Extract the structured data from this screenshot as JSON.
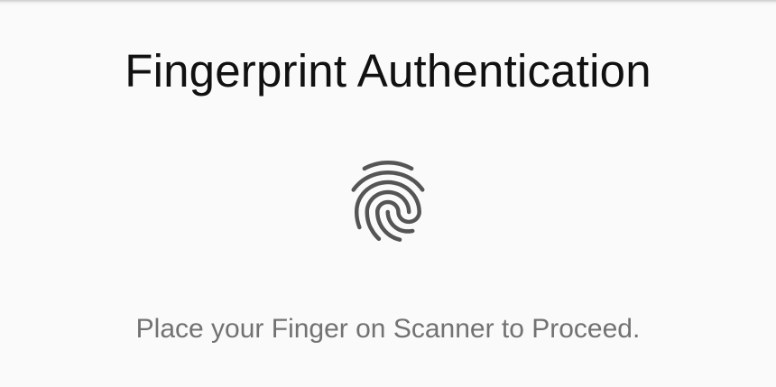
{
  "screen": {
    "title": "Fingerprint Authentication",
    "fingerprint_icon": "fingerprint-icon",
    "instruction": "Place your Finger on Scanner to Proceed."
  },
  "colors": {
    "background": "#fafafa",
    "title_text": "#111111",
    "instruction_text": "#727272",
    "icon": "#555555"
  }
}
